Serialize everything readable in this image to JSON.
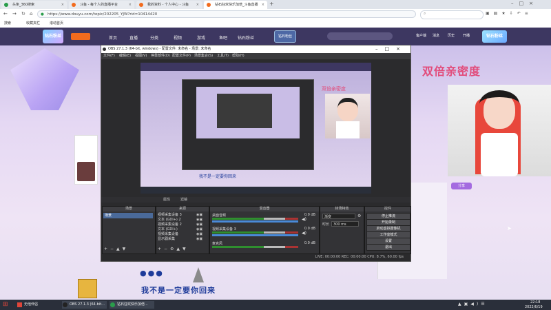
{
  "browser": {
    "tabs": [
      {
        "label": "头条_360搜索",
        "active": false
      },
      {
        "label": "斗鱼 - 每个人的直播平台",
        "active": false
      },
      {
        "label": "我的资料 - 个人中心 - 斗鱼",
        "active": false
      },
      {
        "label": "钻石狂欢快乐加倍_斗鱼直播",
        "active": true
      }
    ],
    "url": "https://www.douyu.com/topic/202205_YJW?rid=10414420",
    "bookmarks": [
      "搜索",
      "收藏夹栏",
      "滚动首页"
    ]
  },
  "douyu": {
    "logo_text": "钻石粉丝",
    "nav": [
      "首页",
      "直播",
      "分类",
      "视频",
      "游戏",
      "鱼吧",
      "钻石粉丝"
    ],
    "top_icons": [
      "客户端",
      "消息",
      "历史",
      "开播"
    ],
    "banner_text": "双倍亲密度",
    "fans_badge": "钻石粉丝",
    "share_badge": "分享"
  },
  "obs": {
    "title": "OBS 27.1.3 (64-bit, windows) - 配置文件: 未命名 - 场景: 未命名",
    "menu": [
      "文件(F)",
      "编辑(E)",
      "视图(V)",
      "停靠部件(D)",
      "配置文件(P)",
      "场景集合(S)",
      "工具(T)",
      "帮助(H)"
    ],
    "scenes_title": "场景",
    "scene_item": "场景",
    "sources_title": "来源",
    "sources": [
      "视频采集设备 3",
      "文本 (GDI+) 2",
      "视频采集设备 2",
      "文本 (GDI+)",
      "视频采集设备",
      "显示器采集"
    ],
    "mixer_title": "混音器",
    "mixer": [
      {
        "name": "桌面音频",
        "db": "0.0 dB"
      },
      {
        "name": "视频采集设备 3",
        "db": "0.0 dB"
      },
      {
        "name": "麦克风",
        "db": "0.0 dB"
      }
    ],
    "transitions_title": "转场特效",
    "transition_value": "渐变",
    "duration_label": "时长",
    "duration_value": "300 ms",
    "controls_title": "控件",
    "controls": [
      "停止推流",
      "开始录制",
      "启动虚拟摄像机",
      "工作室模式",
      "设置",
      "退出"
    ],
    "status": "LIVE: 00:00:00   REC: 00:00:00   CPU: 8.7%, 60.00 fps",
    "no_source_tab": "属性",
    "filter_tab": "滤镜"
  },
  "stream": {
    "subtitle": "我不是一定要你回来",
    "emoji": "●●●"
  },
  "taskbar": {
    "apps": [
      "无他伴侣",
      "OBS 27.1.3 (64-bit...",
      "钻石狂欢快乐加倍..."
    ],
    "time": "22:18",
    "date": "2022/6/19"
  },
  "colors": {
    "douyu_nav": "#3d3761",
    "obs_bg": "#2b2b2d",
    "taskbar": "#2a2f3a",
    "accent_orange": "#f26b1d"
  }
}
